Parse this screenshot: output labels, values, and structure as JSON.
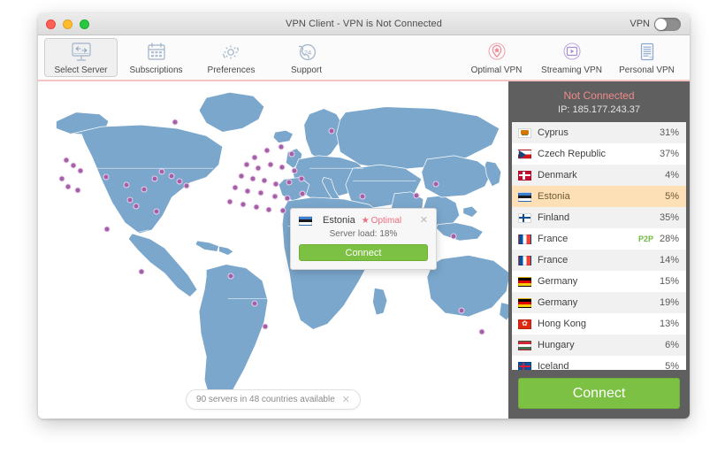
{
  "window": {
    "title": "VPN Client - VPN is Not Connected",
    "toggle_label": "VPN",
    "toggle_state": "off"
  },
  "toolbar": {
    "left_items": [
      {
        "label": "Select Server",
        "icon": "monitor-arrows-icon",
        "selected": true
      },
      {
        "label": "Subscriptions",
        "icon": "calendar-icon",
        "selected": false
      },
      {
        "label": "Preferences",
        "icon": "gear-icon",
        "selected": false
      },
      {
        "label": "Support",
        "icon": "phone-24-icon",
        "selected": false
      }
    ],
    "right_items": [
      {
        "label": "Optimal VPN",
        "icon": "pin-star-icon",
        "color": "#ef8a95"
      },
      {
        "label": "Streaming VPN",
        "icon": "play-box-icon",
        "color": "#a98ed6"
      },
      {
        "label": "Personal VPN",
        "icon": "document-icon",
        "color": "#8ba7cf"
      }
    ],
    "accent_rule_color": "#f4c3c3"
  },
  "map": {
    "land_color": "#7ba7cc",
    "ocean_color": "#ffffff",
    "marker_color": "#a45fa8",
    "status_pill": {
      "text": "90 servers in 48 countries available",
      "close_icon": "close-icon"
    },
    "popup": {
      "country": "Estonia",
      "optimal_label": "Optimal",
      "optimal_star": "★",
      "server_load": "Server load: 18%",
      "connect_label": "Connect",
      "close_icon": "close-icon"
    }
  },
  "sidebar": {
    "status_title": "Not Connected",
    "status_ip": "IP: 185.177.243.37",
    "status_color": "#f08a8a",
    "connect_label": "Connect",
    "connect_color": "#7cc143",
    "servers": [
      {
        "country": "Cyprus",
        "load": "31%",
        "p2p": "",
        "selected": false,
        "flag": "cy"
      },
      {
        "country": "Czech Republic",
        "load": "37%",
        "p2p": "",
        "selected": false,
        "flag": "cz"
      },
      {
        "country": "Denmark",
        "load": "4%",
        "p2p": "",
        "selected": false,
        "flag": "dk"
      },
      {
        "country": "Estonia",
        "load": "5%",
        "p2p": "",
        "selected": true,
        "flag": "ee"
      },
      {
        "country": "Finland",
        "load": "35%",
        "p2p": "",
        "selected": false,
        "flag": "fi"
      },
      {
        "country": "France",
        "load": "28%",
        "p2p": "P2P",
        "selected": false,
        "flag": "fr"
      },
      {
        "country": "France",
        "load": "14%",
        "p2p": "",
        "selected": false,
        "flag": "fr"
      },
      {
        "country": "Germany",
        "load": "15%",
        "p2p": "",
        "selected": false,
        "flag": "de"
      },
      {
        "country": "Germany",
        "load": "19%",
        "p2p": "",
        "selected": false,
        "flag": "de"
      },
      {
        "country": "Hong Kong",
        "load": "13%",
        "p2p": "",
        "selected": false,
        "flag": "hk"
      },
      {
        "country": "Hungary",
        "load": "6%",
        "p2p": "",
        "selected": false,
        "flag": "hu"
      },
      {
        "country": "Iceland",
        "load": "5%",
        "p2p": "",
        "selected": false,
        "flag": "is"
      }
    ]
  }
}
